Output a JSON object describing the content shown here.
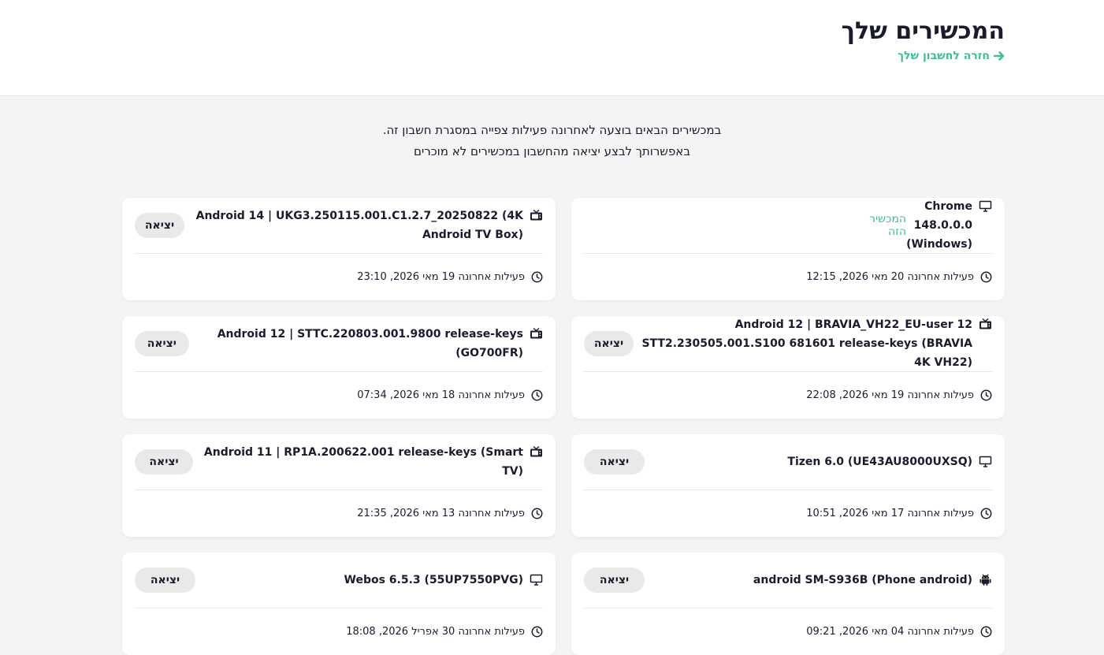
{
  "header": {
    "title": "המכשירים שלך",
    "back_link": "חזרה לחשבון שלך"
  },
  "intro": {
    "line1": "במכשירים הבאים בוצעה לאחרונה פעילות צפייה במסגרת חשבון זה.",
    "line2": "באפשרותך לבצע יציאה מהחשבון במכשירים לא מוכרים"
  },
  "colors": {
    "accent": "#3bbf8f",
    "text": "#1b1b2f",
    "background": "#f4f4f4"
  },
  "devices": [
    {
      "name": "Chrome 148.0.0.0 (Windows)",
      "icon": "monitor-icon",
      "current_label": "המכשיר הזה",
      "activity": "פעילות אחרונה 20 מאי 2026, 12:15"
    },
    {
      "name": "Android 14 | UKG3.250115.001.C1.2.7_20250822 (4K Android TV Box)",
      "icon": "tv-icon",
      "logout_label": "יציאה",
      "activity": "פעילות אחרונה 19 מאי 2026, 23:10"
    },
    {
      "name": "Android 12 | BRAVIA_VH22_EU-user 12 STT2.230505.001.S100 681601 release-keys (BRAVIA 4K VH22)",
      "icon": "tv-icon",
      "logout_label": "יציאה",
      "activity": "פעילות אחרונה 19 מאי 2026, 22:08"
    },
    {
      "name": "Android 12 | STTC.220803.001.9800 release-keys (GO700FR)",
      "icon": "tv-icon",
      "logout_label": "יציאה",
      "activity": "פעילות אחרונה 18 מאי 2026, 07:34"
    },
    {
      "name": "Tizen 6.0 (UE43AU8000UXSQ)",
      "icon": "monitor-icon",
      "logout_label": "יציאה",
      "activity": "פעילות אחרונה 17 מאי 2026, 10:51"
    },
    {
      "name": "Android 11 | RP1A.200622.001 release-keys (Smart TV)",
      "icon": "tv-icon",
      "logout_label": "יציאה",
      "activity": "פעילות אחרונה 13 מאי 2026, 21:35"
    },
    {
      "name": "android SM-S936B (Phone android)",
      "icon": "android-icon",
      "logout_label": "יציאה",
      "activity": "פעילות אחרונה 04 מאי 2026, 09:21"
    },
    {
      "name": "Webos 6.5.3 (55UP7550PVG)",
      "icon": "monitor-icon",
      "logout_label": "יציאה",
      "activity": "פעילות אחרונה 30 אפריל 2026, 18:08"
    }
  ]
}
